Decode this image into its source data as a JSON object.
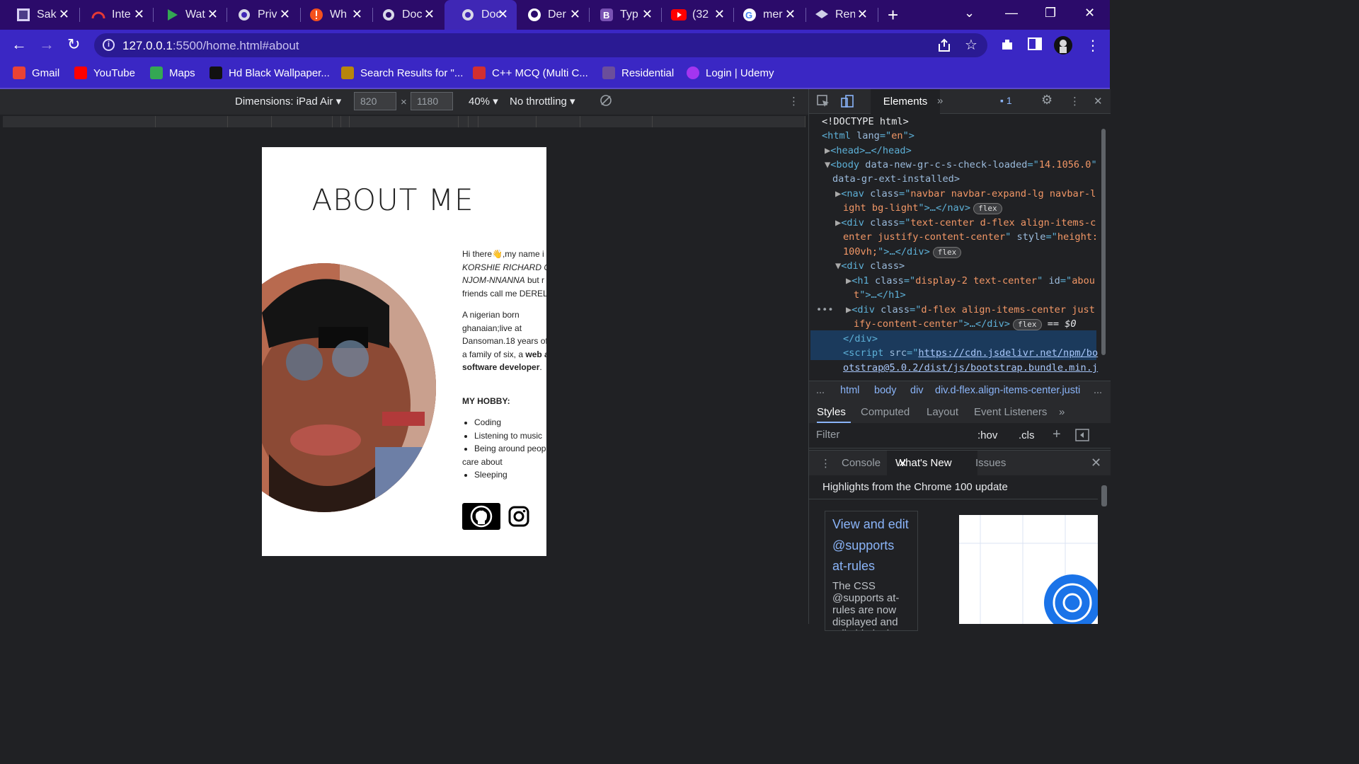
{
  "tabs": [
    {
      "title": "Sak",
      "icon": "sakura-icon"
    },
    {
      "title": "Inte",
      "icon": "speedometer-icon"
    },
    {
      "title": "Wat",
      "icon": "play-icon"
    },
    {
      "title": "Priv",
      "icon": "globe-icon"
    },
    {
      "title": "Wh",
      "icon": "alert-icon"
    },
    {
      "title": "Doc",
      "icon": "globe-icon"
    },
    {
      "title": "Doc",
      "icon": "globe-icon",
      "active": true
    },
    {
      "title": "Der",
      "icon": "github-icon"
    },
    {
      "title": "Typ",
      "icon": "bootstrap-icon"
    },
    {
      "title": "(32",
      "icon": "youtube-icon"
    },
    {
      "title": "mer",
      "icon": "google-icon"
    },
    {
      "title": "Ren",
      "icon": "layers-icon"
    }
  ],
  "address": {
    "host": "127.0.0.1",
    "rest": ":5500/home.html#about"
  },
  "bookmarks": [
    {
      "label": "Gmail",
      "color": "#ea4335"
    },
    {
      "label": "YouTube",
      "color": "#ff0000"
    },
    {
      "label": "Maps",
      "color": "#34a853"
    },
    {
      "label": "Hd Black Wallpaper...",
      "color": "#111111"
    },
    {
      "label": "Search Results for \"...",
      "color": "#b8860b"
    },
    {
      "label": "C++ MCQ (Multi C...",
      "color": "#d32f2f"
    },
    {
      "label": "Residential",
      "color": "#6b4e9b"
    },
    {
      "label": "Login | Udemy",
      "color": "#a435f0"
    }
  ],
  "device_toolbar": {
    "dimensions_label": "Dimensions: iPad Air",
    "width": "820",
    "height": "1180",
    "times": "×",
    "zoom": "40%",
    "throttling": "No throttling"
  },
  "page": {
    "title": "ABOUT ME",
    "bio1_a": "Hi there👋,my name i",
    "bio1_b": "KORSHIE RICHARD CH",
    "bio1_c": "NJOM-NNANNA",
    "bio1_c2": " but r",
    "bio1_d": "friends call me DEREL",
    "bio2_a": "A nigerian born",
    "bio2_b": "ghanaian;live at",
    "bio2_c": "Dansoman.18 years of",
    "bio2_d1": "a family of six, a ",
    "bio2_d2": "web a",
    "bio2_e": "software developer",
    "bio2_e2": ".",
    "hobby_heading": "MY HOBBY:",
    "hobbies": [
      "Coding",
      "Listening to music",
      "Being around peop",
      "Sleeping"
    ],
    "hobby_cont": "care about"
  },
  "devtools": {
    "elements_tab": "Elements",
    "issues_count": "1",
    "dom": {
      "l1": "<!DOCTYPE html>",
      "l2a": "<html ",
      "l2b": "lang",
      "l2c": "=\"",
      "l2d": "en",
      "l2e": "\">",
      "l3": "<head>…</head>",
      "l4a": "<body ",
      "l4b": "data-new-gr-c-s-check-loaded",
      "l4c": "=\"",
      "l4d": "14.1056.0",
      "l4e": "\"",
      "l5": "data-gr-ext-installed>",
      "l6a": "<nav ",
      "l6b": "class",
      "l6c": "=\"",
      "l6d": "navbar navbar-expand-lg navbar-l",
      "l7a": "ight bg-light",
      "l7b": "\">…</nav>",
      "l8a": "<div ",
      "l8b": "class",
      "l8c": "=\"",
      "l8d": "text-center d-flex align-items-c",
      "l9a": "enter justify-content-center",
      "l9b": "\" ",
      "l9c": "style",
      "l9d": "=\"",
      "l9e": "height:",
      "l10a": "100vh;",
      "l10b": "\">…</div>",
      "l11a": "<div ",
      "l11b": "class>",
      "l12a": "<h1 ",
      "l12b": "class",
      "l12c": "=\"",
      "l12d": "display-2 text-center",
      "l12e": "\" ",
      "l12f": "id",
      "l12g": "=\"",
      "l12h": "abou",
      "l13a": "t",
      "l13b": "\">…</h1>",
      "l14a": "<div ",
      "l14b": "class",
      "l14c": "=\"",
      "l14d": "d-flex align-items-center just",
      "l15a": "ify-content-center",
      "l15b": "\">…</div>",
      "l15c": "== $0",
      "l16": "</div>",
      "l17a": "<script ",
      "l17b": "src",
      "l17c": "=\"",
      "l17d": "https://cdn.jsdelivr.net/npm/bo",
      "l18": "otstrap@5.0.2/dist/js/bootstrap.bundle.min.j",
      "flex": "flex"
    },
    "breadcrumbs": [
      "...",
      "html",
      "body",
      "div",
      "div.d-flex.align-items-center.justi",
      "..."
    ],
    "styles_tabs": [
      "Styles",
      "Computed",
      "Layout",
      "Event Listeners"
    ],
    "filter_placeholder": "Filter",
    "hov": ":hov",
    "cls": ".cls",
    "drawer_tabs": [
      "Console",
      "What's New",
      "Issues"
    ],
    "highlights": "Highlights from the Chrome 100 update",
    "card_title": "View and edit @supports at-rules",
    "card_body": "The CSS @supports at-rules are now displayed and editable in the"
  }
}
